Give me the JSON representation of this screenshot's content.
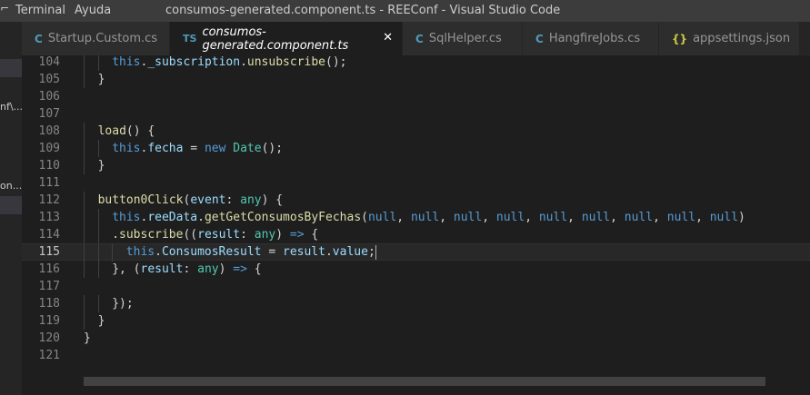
{
  "titlebar": {
    "menu": [
      "Terminal",
      "Ayuda"
    ],
    "window_title": "consumos-generated.component.ts - REEConf - Visual Studio Code"
  },
  "tabs": [
    {
      "icon": "C",
      "icon_name": "csharp-file-icon",
      "label": "Startup.Custom.cs",
      "active": false
    },
    {
      "icon": "TS",
      "icon_name": "typescript-file-icon",
      "label": "consumos-generated.component.ts",
      "active": true
    },
    {
      "icon": "C",
      "icon_name": "csharp-file-icon",
      "label": "SqlHelper.cs",
      "active": false
    },
    {
      "icon": "C",
      "icon_name": "csharp-file-icon",
      "label": "HangfireJobs.cs",
      "active": false
    },
    {
      "icon": "{}",
      "icon_name": "json-file-icon",
      "label": "appsettings.json",
      "active": false
    }
  ],
  "sidebar": {
    "fragments": [
      "nf\\...",
      "on..."
    ]
  },
  "editor": {
    "current_line": 115,
    "lines": [
      {
        "n": "104",
        "tokens": [
          [
            "this",
            "k-this"
          ],
          [
            ".",
            "k-plain"
          ],
          [
            "_subscription",
            "k-prop"
          ],
          [
            ".",
            "k-plain"
          ],
          [
            "unsubscribe",
            "k-fn"
          ],
          [
            "();",
            "k-plain"
          ]
        ],
        "indent": 2
      },
      {
        "n": "105",
        "tokens": [
          [
            "}",
            "k-plain"
          ]
        ],
        "indent": 1
      },
      {
        "n": "106",
        "tokens": [],
        "indent": 0
      },
      {
        "n": "107",
        "tokens": [],
        "indent": 0
      },
      {
        "n": "108",
        "tokens": [
          [
            "load",
            "k-fn"
          ],
          [
            "() {",
            "k-plain"
          ]
        ],
        "indent": 1
      },
      {
        "n": "109",
        "tokens": [
          [
            "this",
            "k-this"
          ],
          [
            ".",
            "k-plain"
          ],
          [
            "fecha",
            "k-prop"
          ],
          [
            " = ",
            "k-plain"
          ],
          [
            "new",
            "k-new"
          ],
          [
            " ",
            "k-plain"
          ],
          [
            "Date",
            "k-type"
          ],
          [
            "();",
            "k-plain"
          ]
        ],
        "indent": 2
      },
      {
        "n": "110",
        "tokens": [
          [
            "}",
            "k-plain"
          ]
        ],
        "indent": 1
      },
      {
        "n": "111",
        "tokens": [],
        "indent": 0
      },
      {
        "n": "112",
        "tokens": [
          [
            "button0Click",
            "k-fn"
          ],
          [
            "(",
            "k-plain"
          ],
          [
            "event",
            "k-param"
          ],
          [
            ": ",
            "k-plain"
          ],
          [
            "any",
            "k-any"
          ],
          [
            ") {",
            "k-plain"
          ]
        ],
        "indent": 1
      },
      {
        "n": "113",
        "tokens": [
          [
            "this",
            "k-this"
          ],
          [
            ".",
            "k-plain"
          ],
          [
            "reeData",
            "k-prop"
          ],
          [
            ".",
            "k-plain"
          ],
          [
            "getGetConsumosByFechas",
            "k-fn"
          ],
          [
            "(",
            "k-plain"
          ],
          [
            "null",
            "k-null"
          ],
          [
            ", ",
            "k-plain"
          ],
          [
            "null",
            "k-null"
          ],
          [
            ", ",
            "k-plain"
          ],
          [
            "null",
            "k-null"
          ],
          [
            ", ",
            "k-plain"
          ],
          [
            "null",
            "k-null"
          ],
          [
            ", ",
            "k-plain"
          ],
          [
            "null",
            "k-null"
          ],
          [
            ", ",
            "k-plain"
          ],
          [
            "null",
            "k-null"
          ],
          [
            ", ",
            "k-plain"
          ],
          [
            "null",
            "k-null"
          ],
          [
            ", ",
            "k-plain"
          ],
          [
            "null",
            "k-null"
          ],
          [
            ", ",
            "k-plain"
          ],
          [
            "null",
            "k-null"
          ],
          [
            ")",
            "k-plain"
          ]
        ],
        "indent": 2
      },
      {
        "n": "114",
        "tokens": [
          [
            ".",
            "k-plain"
          ],
          [
            "subscribe",
            "k-fn"
          ],
          [
            "((",
            "k-plain"
          ],
          [
            "result",
            "k-param"
          ],
          [
            ": ",
            "k-plain"
          ],
          [
            "any",
            "k-any"
          ],
          [
            ") ",
            "k-plain"
          ],
          [
            "=>",
            "k-arrow"
          ],
          [
            " {",
            "k-plain"
          ]
        ],
        "indent": 2
      },
      {
        "n": "115",
        "tokens": [
          [
            "this",
            "k-this"
          ],
          [
            ".",
            "k-plain"
          ],
          [
            "ConsumosResult",
            "k-prop"
          ],
          [
            " = ",
            "k-plain"
          ],
          [
            "result",
            "k-param"
          ],
          [
            ".",
            "k-plain"
          ],
          [
            "value",
            "k-prop"
          ],
          [
            ";",
            "k-plain"
          ]
        ],
        "indent": 3,
        "cursor": true
      },
      {
        "n": "116",
        "tokens": [
          [
            "}, (",
            "k-plain"
          ],
          [
            "result",
            "k-param"
          ],
          [
            ": ",
            "k-plain"
          ],
          [
            "any",
            "k-any"
          ],
          [
            ") ",
            "k-plain"
          ],
          [
            "=>",
            "k-arrow"
          ],
          [
            " {",
            "k-plain"
          ]
        ],
        "indent": 2
      },
      {
        "n": "117",
        "tokens": [],
        "indent": 0
      },
      {
        "n": "118",
        "tokens": [
          [
            "});",
            "k-plain"
          ]
        ],
        "indent": 2
      },
      {
        "n": "119",
        "tokens": [
          [
            "}",
            "k-plain"
          ]
        ],
        "indent": 1
      },
      {
        "n": "120",
        "tokens": [
          [
            "}",
            "k-plain"
          ]
        ],
        "indent": 0
      },
      {
        "n": "121",
        "tokens": [],
        "indent": 0
      }
    ]
  }
}
